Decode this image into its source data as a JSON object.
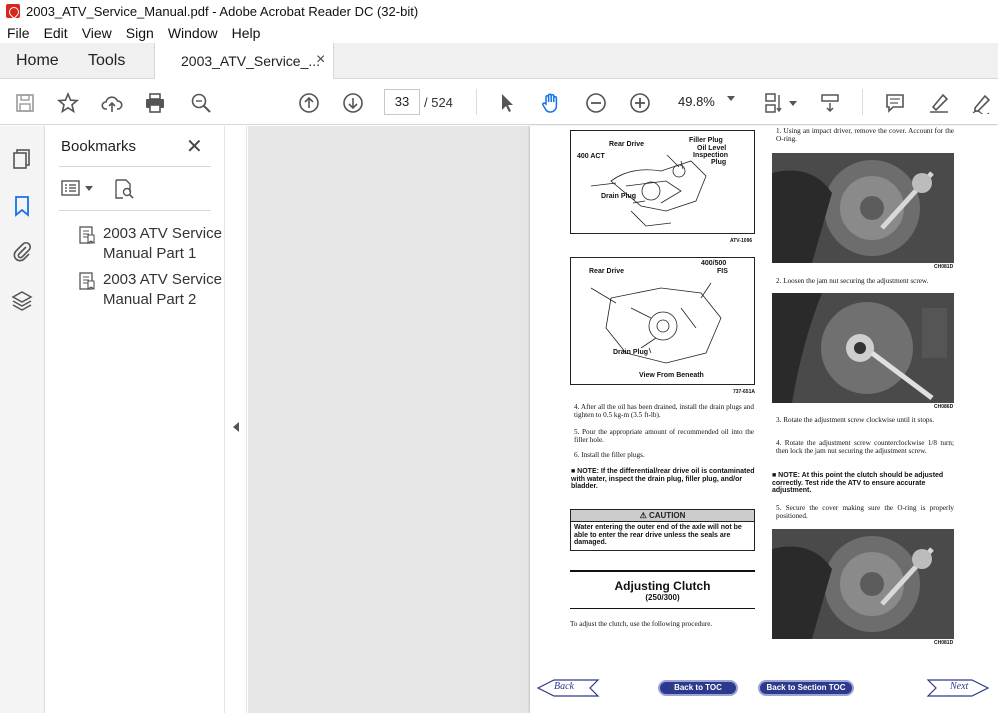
{
  "window": {
    "title": "2003_ATV_Service_Manual.pdf - Adobe Acrobat Reader DC (32-bit)"
  },
  "menu": [
    "File",
    "Edit",
    "View",
    "Sign",
    "Window",
    "Help"
  ],
  "tabs": {
    "home": "Home",
    "tools": "Tools",
    "document": "2003_ATV_Service_...",
    "close": "×"
  },
  "toolbar": {
    "page_current": "33",
    "page_total": "/  524",
    "zoom": "49.8%"
  },
  "bookmarks": {
    "title": "Bookmarks",
    "close": "✕",
    "items": [
      {
        "label": "2003 ATV Service Manual Part 1"
      },
      {
        "label": "2003 ATV Service Manual Part 2"
      }
    ]
  },
  "pdf": {
    "fig1": {
      "labels": [
        "Rear Drive",
        "Filler Plug",
        "Oil Level",
        "Inspection",
        "Plug",
        "400 ACT",
        "Drain Plug"
      ],
      "id": "ATV-1096"
    },
    "fig2": {
      "labels": [
        "Rear Drive",
        "400/500",
        "FIS",
        "Drain Plug",
        "View From Beneath"
      ],
      "id": "737-651A"
    },
    "left_steps": [
      "4. After all the oil has been drained, install the drain plugs and tighten to 0.5 kg-m (3.5 ft-lb).",
      "5. Pour the appropriate amount of recommended oil into the filler hole.",
      "6. Install the filler plugs."
    ],
    "left_note": "■ NOTE: If the differential/rear drive oil is contaminated with water, inspect the drain plug, filler plug, and/or bladder.",
    "caution": {
      "title": "⚠ CAUTION",
      "body": "Water entering the outer end of the axle will not be able to enter the rear drive unless the seals are damaged."
    },
    "section": {
      "title": "Adjusting Clutch",
      "subtitle": "(250/300)"
    },
    "intro": "To adjust the clutch, use the following procedure.",
    "right_steps": [
      "1. Using an impact driver, remove the cover. Account for the O-ring.",
      "2. Loosen the jam nut securing the adjustment screw.",
      "3. Rotate the adjustment screw clockwise until it stops.",
      "4. Rotate the adjustment screw counterclockwise 1/8 turn; then lock the jam nut securing the adjustment screw.",
      "5. Secure the cover making sure the O-ring is properly positioned."
    ],
    "right_note": "■ NOTE: At this point the clutch should be adjusted correctly. Test ride the ATV to ensure accurate adjustment.",
    "photo_ids": [
      "CH081D",
      "CH086D",
      "CH081D"
    ],
    "nav": {
      "back": "Back",
      "toc": "Back to TOC",
      "section_toc": "Back to Section TOC",
      "next": "Next"
    }
  }
}
